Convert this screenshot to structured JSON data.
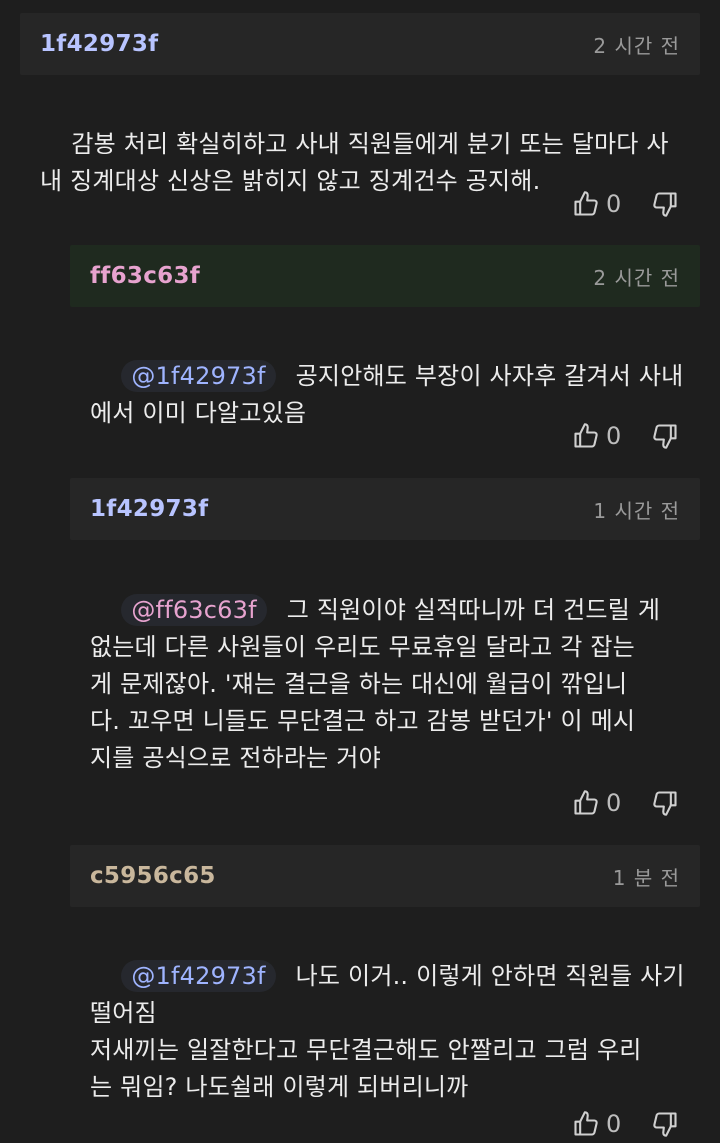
{
  "colors": {
    "background": "#1e1e1e",
    "header_default": "#262626",
    "header_highlight": "#1f2a1f",
    "id_blue": "#b8c4ff",
    "id_pink": "#e7a3cf",
    "id_tan": "#c9b79c",
    "mention_blue": "#9fb4ff",
    "mention_pink": "#e7a3cf"
  },
  "comments": [
    {
      "author": "1f42973f",
      "time": "2 시간 전",
      "mention": "",
      "text": "감봉 처리 확실히하고 사내 직원들에게 분기 또는 달마다 사\n내 징계대상 신상은 밝히지 않고 징계건수 공지해.",
      "likes": "0"
    },
    {
      "author": "ff63c63f",
      "time": "2 시간 전",
      "mention": "@1f42973f",
      "text": "공지안해도 부장이 사자후 갈겨서 사내\n에서 이미 다알고있음",
      "likes": "0"
    },
    {
      "author": "1f42973f",
      "time": "1 시간 전",
      "mention": "@ff63c63f",
      "text": "그 직원이야 실적따니까 더 건드릴 게\n없는데 다른 사원들이 우리도 무료휴일 달라고 각 잡는\n게 문제잖아. '쟤는 결근을 하는 대신에 월급이 깎입니\n다. 꼬우면 니들도 무단결근 하고 감봉 받던가' 이 메시\n지를 공식으로 전하라는 거야",
      "likes": "0"
    },
    {
      "author": "c5956c65",
      "time": "1 분 전",
      "mention": "@1f42973f",
      "text": "나도 이거.. 이렇게 안하면 직원들 사기\n떨어짐\n저새끼는 일잘한다고 무단결근해도 안짤리고 그럼 우리\n는 뭐임? 나도쉴래 이렇게 되버리니까",
      "likes": "0"
    }
  ]
}
